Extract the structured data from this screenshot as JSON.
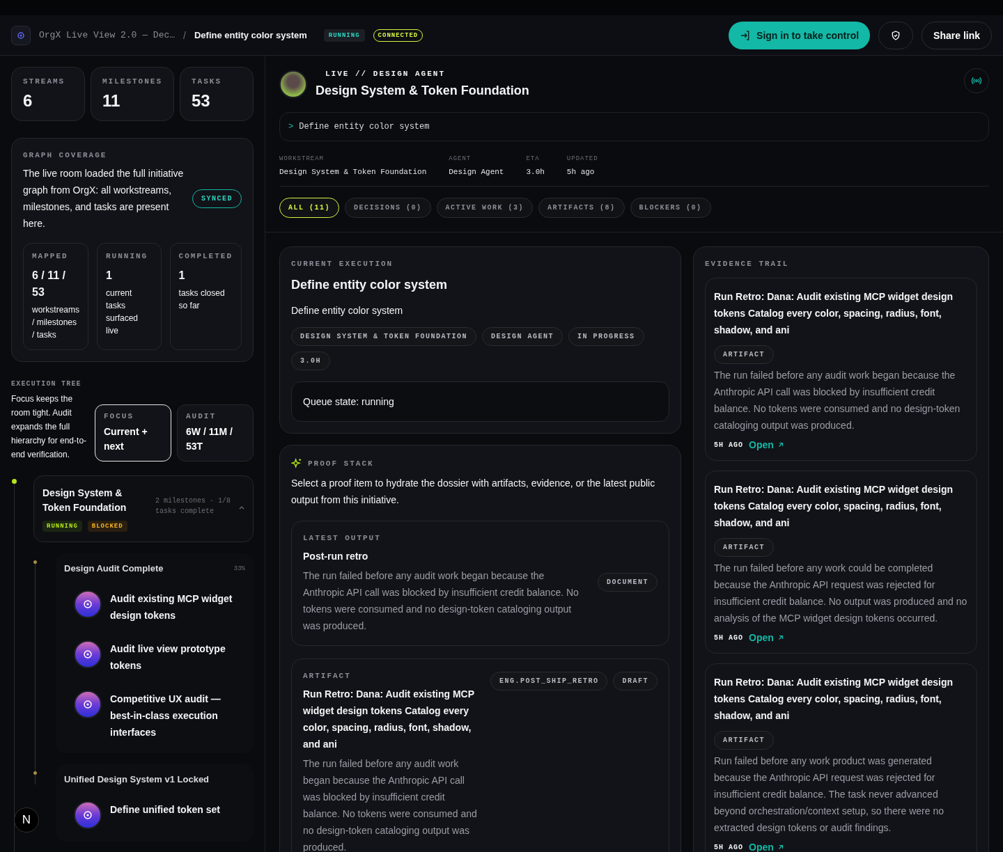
{
  "header": {
    "breadcrumb_parent": "OrgX Live View 2.0 — Dec…",
    "separator": "/",
    "title": "Define entity color system",
    "badges": [
      {
        "label": "RUNNING",
        "kind": "status"
      },
      {
        "label": "CONNECTED",
        "kind": "outline"
      }
    ],
    "sign_in": "Sign in to take control",
    "share": "Share link"
  },
  "sidebar": {
    "stats": [
      {
        "label": "STREAMS",
        "value": "6"
      },
      {
        "label": "MILESTONES",
        "value": "11"
      },
      {
        "label": "TASKS",
        "value": "53"
      }
    ],
    "coverage": {
      "heading": "GRAPH COVERAGE",
      "text": "The live room loaded the full initiative graph from OrgX: all workstreams, milestones, and tasks are present here.",
      "badge": "SYNCED",
      "cards": [
        {
          "label": "MAPPED",
          "value": "6 / 11 / 53",
          "caption": "workstreams / milestones / tasks"
        },
        {
          "label": "RUNNING",
          "value": "1",
          "caption": "current tasks surfaced live"
        },
        {
          "label": "COMPLETED",
          "value": "1",
          "caption": "tasks closed so far"
        }
      ]
    },
    "tree": {
      "heading": "EXECUTION TREE",
      "text": "Focus keeps the room tight. Audit expands the full hierarchy for end-to-end verification.",
      "modes": [
        {
          "label": "FOCUS",
          "value": "Current + next",
          "selected": true
        },
        {
          "label": "AUDIT",
          "value": "6W / 11M / 53T",
          "selected": false
        }
      ],
      "workstreams": [
        {
          "title": "Design System & Token Foundation",
          "meta": "2 milestones · 1/8 tasks complete",
          "expanded": true,
          "badges": [
            {
              "label": "RUNNING",
              "kind": "running"
            },
            {
              "label": "BLOCKED",
              "kind": "blocked"
            }
          ],
          "milestones": [
            {
              "title": "Design Audit Complete",
              "percent": "33%",
              "tasks": [
                {
                  "title": "Audit existing MCP widget design tokens"
                },
                {
                  "title": "Audit live view prototype tokens"
                },
                {
                  "title": "Competitive UX audit — best-in-class execution interfaces"
                }
              ]
            },
            {
              "title": "Unified Design System v1 Locked",
              "tasks": [
                {
                  "title": "Define unified token set"
                }
              ]
            }
          ]
        }
      ]
    },
    "dev_badge": "N"
  },
  "main": {
    "agent": {
      "kicker": "LIVE // DESIGN AGENT",
      "title": "Design System & Token Foundation"
    },
    "command": {
      "prompt": ">",
      "text": "Define entity color system"
    },
    "meta": [
      {
        "label": "WORKSTREAM",
        "value": "Design System & Token Foundation"
      },
      {
        "label": "AGENT",
        "value": "Design Agent"
      },
      {
        "label": "ETA",
        "value": "3.0h"
      },
      {
        "label": "UPDATED",
        "value": "5h ago"
      }
    ],
    "filters": [
      {
        "label": "ALL (11)",
        "selected": true
      },
      {
        "label": "DECISIONS (0)",
        "selected": false
      },
      {
        "label": "ACTIVE WORK (3)",
        "selected": false
      },
      {
        "label": "ARTIFACTS (8)",
        "selected": false
      },
      {
        "label": "BLOCKERS (0)",
        "selected": false
      }
    ],
    "current": {
      "heading": "CURRENT EXECUTION",
      "title": "Define entity color system",
      "subtitle": "Define entity color system",
      "tags": [
        "DESIGN SYSTEM & TOKEN FOUNDATION",
        "DESIGN AGENT",
        "IN PROGRESS",
        "3.0H"
      ],
      "queue": "Queue state: running"
    },
    "proof": {
      "heading": "PROOF STACK",
      "intro": "Select a proof item to hydrate the dossier with artifacts, evidence, or the latest public output from this initiative.",
      "items": [
        {
          "label": "LATEST OUTPUT",
          "title": "Post-run retro",
          "body": "The run failed before any audit work began because the Anthropic API call was blocked by insufficient credit balance. No tokens were consumed and no design-token cataloging output was produced.",
          "tags": [
            "DOCUMENT"
          ]
        },
        {
          "label": "ARTIFACT",
          "title": "Run Retro: Dana: Audit existing MCP widget design tokens Catalog every color, spacing, radius, font, shadow, and ani",
          "body": "The run failed before any audit work began because the Anthropic API call was blocked by insufficient credit balance. No tokens were consumed and no design-token cataloging output was produced.",
          "tags": [
            "ENG.POST_SHIP_RETRO",
            "DRAFT"
          ]
        }
      ]
    },
    "evidence": {
      "heading": "EVIDENCE TRAIL",
      "items": [
        {
          "title": "Run Retro: Dana: Audit existing MCP widget design tokens Catalog every color, spacing, radius, font, shadow, and ani",
          "tag": "ARTIFACT",
          "body": "The run failed before any audit work began because the Anthropic API call was blocked by insufficient credit balance. No tokens were consumed and no design-token cataloging output was produced.",
          "time": "5H AGO",
          "link": "Open"
        },
        {
          "title": "Run Retro: Dana: Audit existing MCP widget design tokens Catalog every color, spacing, radius, font, shadow, and ani",
          "tag": "ARTIFACT",
          "body": "The run failed before any work could be completed because the Anthropic API request was rejected for insufficient credit balance. No output was produced and no analysis of the MCP widget design tokens occurred.",
          "time": "5H AGO",
          "link": "Open"
        },
        {
          "title": "Run Retro: Dana: Audit existing MCP widget design tokens Catalog every color, spacing, radius, font, shadow, and ani",
          "tag": "ARTIFACT",
          "body": "Run failed before any work product was generated because the Anthropic API request was rejected for insufficient credit balance. The task never advanced beyond orchestration/context setup, so there were no extracted design tokens or audit findings.",
          "time": "5H AGO",
          "link": "Open"
        }
      ]
    }
  }
}
